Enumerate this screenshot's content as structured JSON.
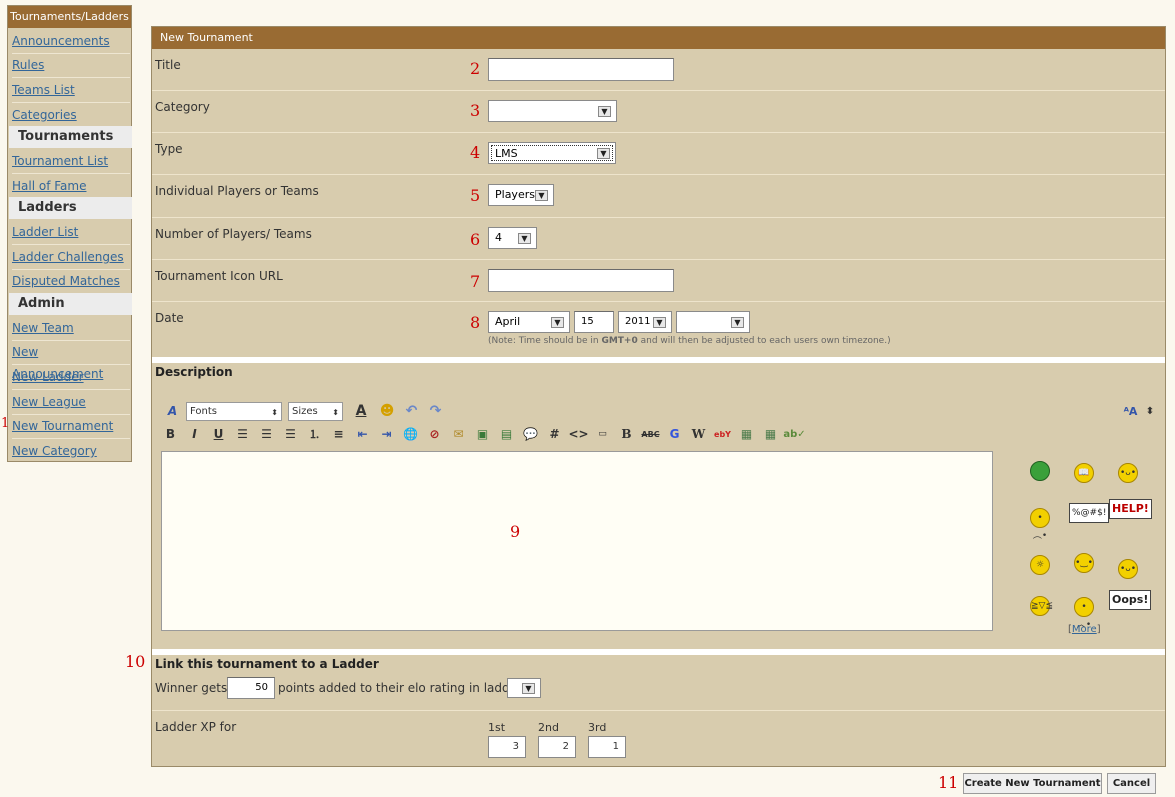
{
  "sidebar": {
    "title": "Tournaments/Ladders",
    "items": [
      {
        "label": "Announcements"
      },
      {
        "label": "Rules"
      },
      {
        "label": "Teams List"
      },
      {
        "label": "Categories"
      }
    ],
    "section_tournaments": "Tournaments",
    "tournament_items": [
      {
        "label": "Tournament List"
      },
      {
        "label": "Hall of Fame"
      }
    ],
    "section_ladders": "Ladders",
    "ladder_items": [
      {
        "label": "Ladder List"
      },
      {
        "label": "Ladder Challenges"
      },
      {
        "label": "Disputed Matches"
      }
    ],
    "section_admin": "Admin",
    "admin_items": [
      {
        "label": "New Team"
      },
      {
        "label": "New Announcement"
      },
      {
        "label": "New Ladder"
      },
      {
        "label": "New League"
      },
      {
        "label": "New Tournament",
        "marker": "1"
      },
      {
        "label": "New Category"
      }
    ]
  },
  "panel": {
    "title": "New Tournament",
    "fields": {
      "title": {
        "label": "Title",
        "marker": "2",
        "value": ""
      },
      "category": {
        "label": "Category",
        "marker": "3",
        "value": ""
      },
      "type": {
        "label": "Type",
        "marker": "4",
        "value": "LMS"
      },
      "players_or_teams": {
        "label": "Individual Players or Teams",
        "marker": "5",
        "value": "Players"
      },
      "num_players": {
        "label": "Number of Players/ Teams",
        "marker": "6",
        "value": "4"
      },
      "icon_url": {
        "label": "Tournament Icon URL",
        "marker": "7",
        "value": ""
      },
      "date": {
        "label": "Date",
        "marker": "8",
        "month": "April",
        "day": "15",
        "year": "2011",
        "time": "",
        "note_pre": "(Note: Time should be in ",
        "note_bold": "GMT+0",
        "note_post": " and will then be adjusted to each users own timezone.)"
      }
    },
    "description": {
      "heading": "Description",
      "marker": "9",
      "toolbar": {
        "fonts": "Fonts",
        "sizes": "Sizes"
      },
      "smileys": {
        "more_label": "More",
        "help_sign": "HELP!",
        "oops_sign": "Oops!",
        "speech": "%@#$!"
      }
    },
    "ladder": {
      "heading": "Link this tournament to a Ladder",
      "marker": "10",
      "winner_pre": "Winner gets",
      "winner_points": "50",
      "winner_post": "points added to their elo rating in ladder:",
      "ladder_value": "",
      "xp_label": "Ladder XP for",
      "xp": [
        {
          "place": "1st",
          "value": "3"
        },
        {
          "place": "2nd",
          "value": "2"
        },
        {
          "place": "3rd",
          "value": "1"
        }
      ]
    },
    "actions": {
      "marker": "11",
      "create": "Create New Tournament",
      "cancel": "Cancel"
    }
  }
}
